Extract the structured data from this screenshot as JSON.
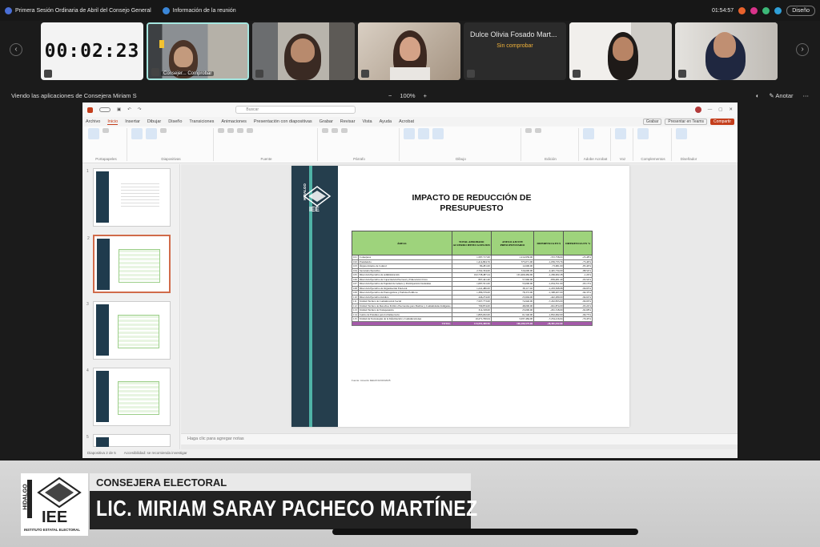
{
  "topbar": {
    "meeting_title": "Primera Sesión Ordinaria de Abril del Consejo General",
    "info_tab": "Información de la reunión",
    "clock": "01:54:57",
    "design_button": "Diseño"
  },
  "participants": {
    "timer": "00:02:23",
    "tiles": [
      {
        "label": "Consejer... Comprobar"
      },
      {
        "label": ""
      },
      {
        "label": ""
      },
      {
        "name": "Dulce Olivia Fosado Mart...",
        "status": "Sin comprobar"
      },
      {
        "label": ""
      },
      {
        "label": ""
      }
    ]
  },
  "viewbar": {
    "viewing_text": "Viendo las aplicaciones de Consejera Miriam S",
    "zoom_out": "−",
    "zoom_level": "100%",
    "zoom_in": "+",
    "annotate": "Anotar"
  },
  "powerpoint": {
    "search_placeholder": "Buscar",
    "menu": [
      "Archivo",
      "Inicio",
      "Insertar",
      "Dibujar",
      "Diseño",
      "Transiciones",
      "Animaciones",
      "Presentación con diapositivas",
      "Grabar",
      "Revisar",
      "Vista",
      "Ayuda",
      "Acrobat"
    ],
    "menu_right": [
      "Grabar",
      "Presentar en Teams",
      "Compartir"
    ],
    "ribbon_groups": [
      "Portapapeles",
      "Diapositivas",
      "Fuente",
      "Párrafo",
      "Dibujo",
      "Edición",
      "Adobe Acrobat",
      "Voz",
      "Complementos",
      "Diseñador"
    ],
    "thumbnail_numbers": [
      "1",
      "2",
      "3",
      "4",
      "5"
    ],
    "notes_placeholder": "Haga clic para agregar notas",
    "status_left": "Diapositiva 2 de 5",
    "status_access": "Accesibilidad: se recomienda investigar"
  },
  "slide": {
    "logo_state": "HIDALGO",
    "logo_acronym": "IEE",
    "title": "IMPACTO DE REDUCCIÓN DE PRESUPUESTO",
    "headers": [
      "ÁREAS",
      "TOTAL APROBADO ACUERDO IEEH/CG/019/2025",
      "ANEXO AJUSTE PRESUPUESTARIO",
      "DIFERENCIA EN $",
      "DIFERENCIA EN %"
    ],
    "rows": [
      [
        "101",
        "Consejeros",
        "1,587,717.00",
        "1,214,959.00",
        "-372,758.00",
        "-23.48%"
      ],
      [
        "102",
        "Presidencia",
        "1,414,804.76",
        "375,071.00",
        "-1,039,733.76",
        "-73.49%"
      ],
      [
        "103",
        "Órgano Interno de Control",
        "86,281.00",
        "12,600.00",
        "-73,681.00",
        "-85.40%"
      ],
      [
        "104",
        "Secretaría Ejecutiva",
        "2,762,334.00",
        "316,600.00",
        "-2,445,734.00",
        "-88.54%"
      ],
      [
        "105",
        "Dirección Ejecutiva de Administración",
        "102,738,487.24",
        "101,469,484.96",
        "-1,269,002.28",
        "-1.24%"
      ],
      [
        "106",
        "Dirección Ejecutiva de Capacitación Electoral y Educación Cívica",
        "897,441.40",
        "57,960.00",
        "-839,481.40",
        "-93.54%"
      ],
      [
        "107",
        "Dirección Ejecutiva de Equidad de Género y Participación Ciudadana",
        "1,087,551.00",
        "53,000.00",
        "-1,034,551.00",
        "-95.13%"
      ],
      [
        "108",
        "Dirección Ejecutiva de Organización Electoral",
        "1,241,486.00",
        "38,117.02",
        "-1,203,368.98",
        "-96.93%"
      ],
      [
        "109",
        "Dirección Ejecutiva de Prerrogativas y Partidos Políticos",
        "1,386,579.00",
        "78,372.00",
        "-1,308,207.00",
        "-94.35%"
      ],
      [
        "110",
        "Dirección Ejecutiva Jurídica",
        "446,274.00",
        "23,994.00",
        "-422,280.00",
        "-94.62%"
      ],
      [
        "111",
        "Unidad Técnica de Comunicación Social",
        "7,507,773.00",
        "74,940.00",
        "-7,432,833.00",
        "-99.00%"
      ],
      [
        "112",
        "Unidad Técnica de Derechos Político Electorales para Pueblos y Comunidades Indígenas",
        "709,874.00",
        "48,000.00",
        "-661,874.00",
        "-93.24%"
      ],
      [
        "113",
        "Unidad Técnica de Transparencia",
        "314,318.00",
        "23,000.00",
        "-291,318.00",
        "-92.68%"
      ],
      [
        "114",
        "Centro de Estudios para la Democracia",
        "1,893,632.00",
        "61,540.00",
        "-1,832,092.00",
        "-96.75%"
      ],
      [
        "115",
        "Unidad de Tecnologías de la Información y Comunicaciones",
        "10,271,700.04",
        "3,037,484.00",
        "-7,234,216.04",
        "-70.43%"
      ]
    ],
    "total": [
      "TOTAL",
      "134,591,408.96",
      "106,180,579.00",
      "-28,381,432.00",
      ""
    ],
    "source": "Fuente: Acuerdo IEEH/CG/019/2025"
  },
  "lower_third": {
    "role": "CONSEJERA ELECTORAL",
    "name": "LIC. MIRIAM SARAY PACHECO MARTÍNEZ",
    "logo_state": "HIDALGO",
    "logo_acronym": "IEE",
    "logo_caption": "INSTITUTO ESTATAL ELECTORAL"
  },
  "colors": {
    "table_header_green": "#9ed37c",
    "total_row_purple": "#a45aa9",
    "slide_band": "#253e4d",
    "accent_teal": "#4fb2a6"
  }
}
